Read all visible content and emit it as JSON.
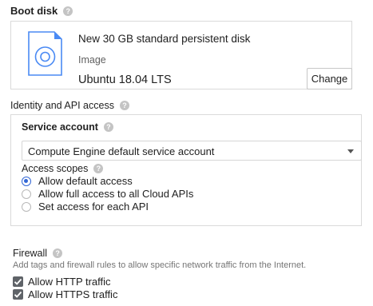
{
  "boot_disk": {
    "title": "Boot disk",
    "disk_title": "New 30 GB standard persistent disk",
    "image_label": "Image",
    "image_value": "Ubuntu 18.04 LTS",
    "change_button": "Change"
  },
  "identity": {
    "title": "Identity and API access",
    "service_account_label": "Service account",
    "service_account_value": "Compute Engine default service account",
    "access_scopes_label": "Access scopes",
    "scopes": [
      {
        "label": "Allow default access",
        "selected": true
      },
      {
        "label": "Allow full access to all Cloud APIs",
        "selected": false
      },
      {
        "label": "Set access for each API",
        "selected": false
      }
    ]
  },
  "firewall": {
    "title": "Firewall",
    "description": "Add tags and firewall rules to allow specific network traffic from the Internet.",
    "options": [
      {
        "label": "Allow HTTP traffic",
        "checked": true
      },
      {
        "label": "Allow HTTPS traffic",
        "checked": true
      }
    ]
  },
  "colors": {
    "accent": "#3367d6",
    "checkbox": "#5f6368",
    "border": "#dadada"
  },
  "icons": [
    "help-icon",
    "disk-image-icon",
    "dropdown-caret-icon",
    "checkmark-icon"
  ]
}
